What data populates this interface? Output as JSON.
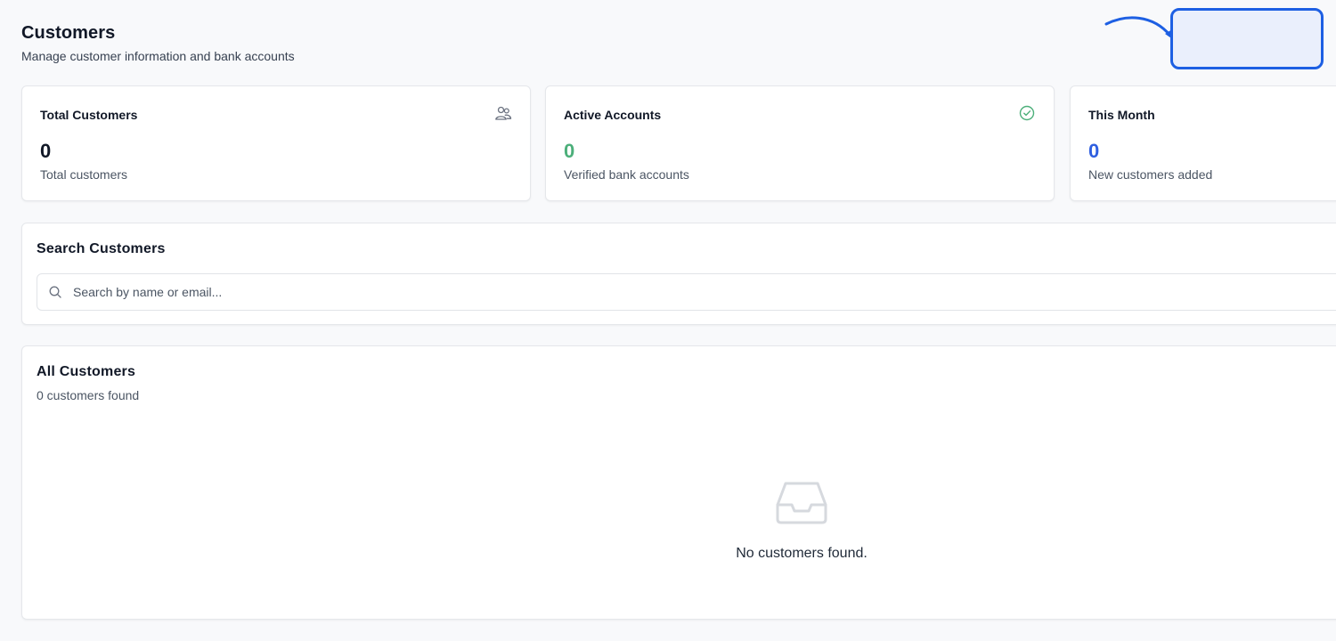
{
  "header": {
    "title": "Customers",
    "subtitle": "Manage customer information and bank accounts"
  },
  "stats": [
    {
      "title": "Total Customers",
      "value": "0",
      "caption": "Total customers",
      "icon": "users-icon"
    },
    {
      "title": "Active Accounts",
      "value": "0",
      "caption": "Verified bank accounts",
      "icon": "check-circle-icon"
    },
    {
      "title": "This Month",
      "value": "0",
      "caption": "New customers added",
      "icon": "calendar-icon"
    }
  ],
  "search": {
    "title": "Search Customers",
    "placeholder": "Search by name or email...",
    "value": ""
  },
  "list": {
    "title": "All Customers",
    "count_text": "0 customers found",
    "empty_text": "No customers found."
  },
  "colors": {
    "accent_green": "#4caf7a",
    "accent_blue": "#2f5fe0",
    "highlight": "#1d5fe3"
  }
}
